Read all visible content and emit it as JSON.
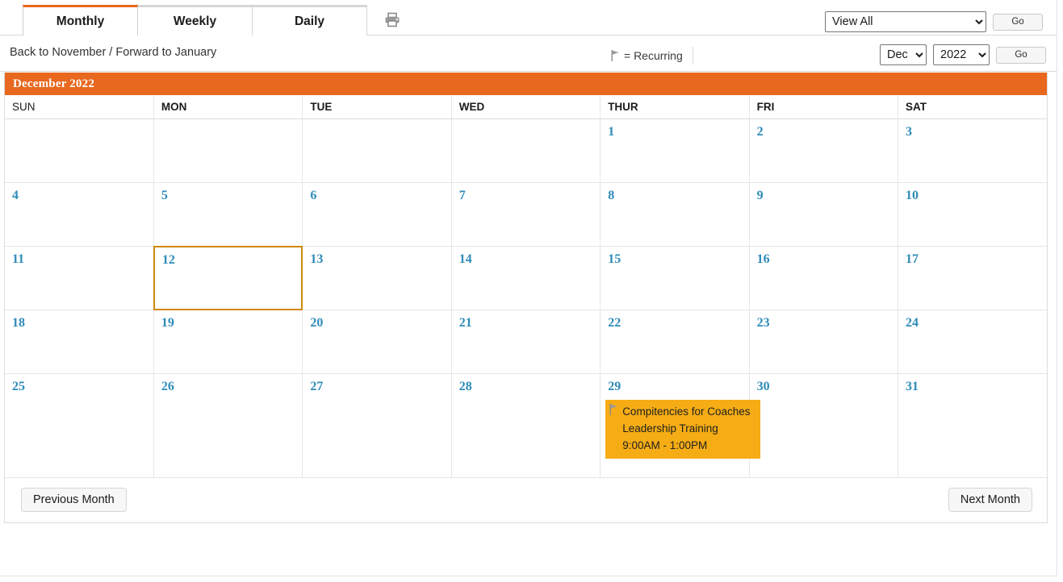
{
  "tabs": [
    {
      "label": "Monthly",
      "active": true
    },
    {
      "label": "Weekly",
      "active": false
    },
    {
      "label": "Daily",
      "active": false
    }
  ],
  "toolbar": {
    "print_icon": "printer-icon",
    "view_filter_value": "View All",
    "go_label": "Go"
  },
  "nav": {
    "links_text": "Back to November / Forward to January",
    "recurring_legend": "= Recurring",
    "recurring_flag_icon": "flag-icon",
    "month_value": "Dec",
    "year_value": "2022",
    "go_label": "Go"
  },
  "calendar": {
    "month_title": "December 2022",
    "weekdays": [
      "SUN",
      "MON",
      "TUE",
      "WED",
      "THUR",
      "FRI",
      "SAT"
    ],
    "weeks": [
      [
        {
          "day": ""
        },
        {
          "day": ""
        },
        {
          "day": ""
        },
        {
          "day": ""
        },
        {
          "day": "1"
        },
        {
          "day": "2"
        },
        {
          "day": "3"
        }
      ],
      [
        {
          "day": "4"
        },
        {
          "day": "5"
        },
        {
          "day": "6"
        },
        {
          "day": "7"
        },
        {
          "day": "8"
        },
        {
          "day": "9"
        },
        {
          "day": "10"
        }
      ],
      [
        {
          "day": "11"
        },
        {
          "day": "12",
          "today": true
        },
        {
          "day": "13"
        },
        {
          "day": "14"
        },
        {
          "day": "15"
        },
        {
          "day": "16"
        },
        {
          "day": "17"
        }
      ],
      [
        {
          "day": "18"
        },
        {
          "day": "19"
        },
        {
          "day": "20"
        },
        {
          "day": "21"
        },
        {
          "day": "22"
        },
        {
          "day": "23"
        },
        {
          "day": "24"
        }
      ],
      [
        {
          "day": "25"
        },
        {
          "day": "26"
        },
        {
          "day": "27"
        },
        {
          "day": "28"
        },
        {
          "day": "29",
          "event": {
            "title": "Compitencies for Coaches Leadership Training",
            "time": "9:00AM - 1:00PM",
            "recurring": true
          }
        },
        {
          "day": "30"
        },
        {
          "day": "31"
        }
      ]
    ]
  },
  "footer": {
    "previous_label": "Previous Month",
    "next_label": "Next Month"
  },
  "colors": {
    "accent_orange": "#e8681f",
    "event_amber": "#f5ac15",
    "day_number_blue": "#2e8bb8",
    "today_border": "#cf8a12"
  }
}
